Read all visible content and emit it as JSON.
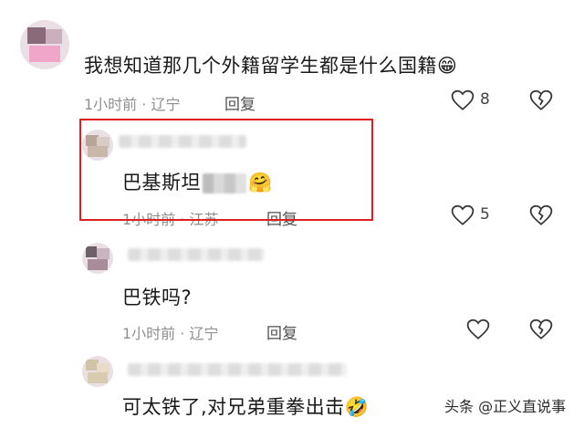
{
  "comments": [
    {
      "text": "我想知道那几个外籍留学生都是什么国籍",
      "emoji": "😁",
      "meta": "1小时前 · 辽宁",
      "reply_label": "回复",
      "like_count": "8"
    },
    {
      "text": "巴基斯坦",
      "emoji": "🤗",
      "meta": "1小时前 · 江苏",
      "reply_label": "回复",
      "like_count": "5"
    },
    {
      "text": "巴铁吗?",
      "meta": "1小时前 · 辽宁",
      "reply_label": "回复"
    },
    {
      "text": "可太铁了,对兄弟重拳出击",
      "emoji": "🤣"
    }
  ],
  "watermark": "头条 @正义直说事",
  "colors": {
    "highlight": "#e02020",
    "text": "#1a1a1a",
    "meta": "#8f8f8f"
  }
}
